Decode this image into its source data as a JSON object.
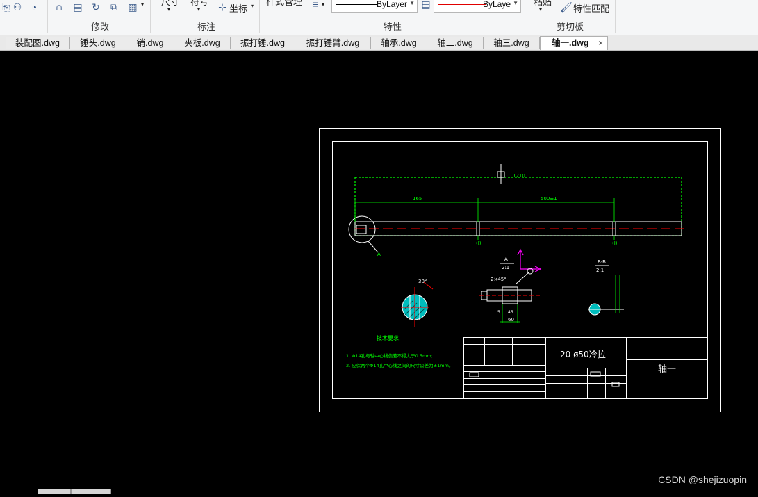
{
  "ribbon": {
    "groups": [
      {
        "title": "修改"
      },
      {
        "title": "标注"
      },
      {
        "title": "特性"
      },
      {
        "title": "剪切板"
      }
    ],
    "dimension_label": "尺寸",
    "symbol_label": "符号",
    "coordinate_label": "坐标",
    "style_manager_label": "样式管理",
    "linetype_value": "ByLayer",
    "color_value": "ByLaye",
    "paste_label": "粘贴",
    "match_prop_label": "特性匹配"
  },
  "tabs": [
    {
      "label": "装配图.dwg"
    },
    {
      "label": "锤头.dwg"
    },
    {
      "label": "销.dwg"
    },
    {
      "label": "夹板.dwg"
    },
    {
      "label": "振打锤.dwg"
    },
    {
      "label": "振打锤臂.dwg"
    },
    {
      "label": "轴承.dwg"
    },
    {
      "label": "轴二.dwg"
    },
    {
      "label": "轴三.dwg"
    },
    {
      "label": "轴一.dwg",
      "active": true
    }
  ],
  "close_glyph": "×",
  "drawing": {
    "dim_top": "1210",
    "dim_left": "165",
    "dim_right": "500±1",
    "marker_a": "A",
    "section_ref_1": "(I)",
    "section_ref_2": "(I)",
    "angle_label": "30°",
    "detail_label": "A",
    "detail_scale": "2:1",
    "chamfer_label": "2×45°",
    "dim_60": "60",
    "dim_45": "45",
    "dim_5": "5",
    "section_label": "B-B",
    "section_scale": "2:1",
    "tech_title": "技术要求",
    "tech_line_1": "1. Φ14孔与轴中心线偏差不得大于0.5mm;",
    "tech_line_2": "2. 应保两个Φ14孔中心线之间的尺寸公差为±1mm。",
    "material": "20  ø50冷拉",
    "part_name": "轴一"
  },
  "watermark": "CSDN @shejizuopin",
  "colors": {
    "ribbon_bg": "#f5f6f7",
    "canvas_bg": "#000000",
    "frame": "#ffffff",
    "dim_green": "#00ff00",
    "center_red": "#ff0000",
    "hatch_cyan": "#00ffff",
    "ucs_magenta": "#ff00ff"
  }
}
